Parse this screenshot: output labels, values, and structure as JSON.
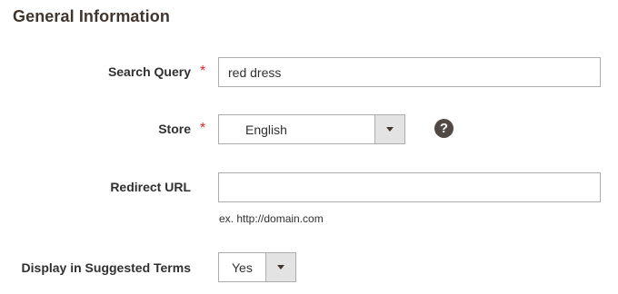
{
  "section": {
    "title": "General Information"
  },
  "fields": {
    "search_query": {
      "label": "Search Query",
      "required_mark": "*",
      "value": "red dress"
    },
    "store": {
      "label": "Store",
      "required_mark": "*",
      "selected": "English",
      "help_icon": "question-circle-icon",
      "help_glyph": "?"
    },
    "redirect_url": {
      "label": "Redirect URL",
      "value": "",
      "note": "ex. http://domain.com"
    },
    "display_in_suggested_terms": {
      "label": "Display in Suggested Terms",
      "selected": "Yes"
    }
  },
  "colors": {
    "required": "#e22626",
    "title": "#41362f",
    "help_icon_bg": "#514943",
    "input_border": "#adadad",
    "select_arrow_bg": "#e3e3e3"
  }
}
